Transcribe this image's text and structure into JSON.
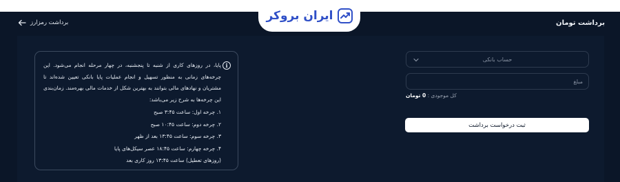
{
  "header": {
    "title": "برداشت تومان",
    "back_label": "برداشت رمزارز",
    "logo_text": "ایران بروکر"
  },
  "info": {
    "paragraph": "پایا، در روزهای کاری از شنبه تا پنجشنبه، در چهار مرحله انجام می‌شود. این چرخه‌های زمانی به منظور تسهیل و انجام عملیات پایا بانکی تعیین شده‌اند تا مشتریان و نهادهای مالی بتوانند به بهترین شکل از خدمات مالی بهره‌مند. زمان‌بندی این چرخه‌ها به شرح زیر می‌باشد:",
    "cycles": [
      "۱. چرخه اول: ساعت ۳:۴۵ صبح",
      "۲. چرخه دوم: ساعت ۱۰:۴۵ صبح",
      "۳. چرخه سوم: ساعت ۱۳:۴۵ بعد از ظهر",
      "۴. چرخه چهارم: ساعت ۱۸:۴۵ عصر سیکل‌های پایا",
      "(روزهای تعطیل) ساعت ۱۳:۴۵ روز کاری بعد"
    ]
  },
  "form": {
    "bank_account_placeholder": "حساب بانکی",
    "amount_placeholder": "مبلغ",
    "amount_value": "",
    "balance_label": "کل موجودی :",
    "balance_value": "0 تومان",
    "submit_label": "ثبت درخواست برداشت"
  },
  "colors": {
    "background": "#0b1628",
    "panel": "#0d1a2e",
    "brand": "#2f4fc7",
    "text": "#e6ebf2"
  },
  "icons": {
    "back": "arrow-left-icon",
    "info": "info-circle-icon",
    "dropdown": "chevron-down-icon",
    "logo": "growth-chart-icon"
  }
}
